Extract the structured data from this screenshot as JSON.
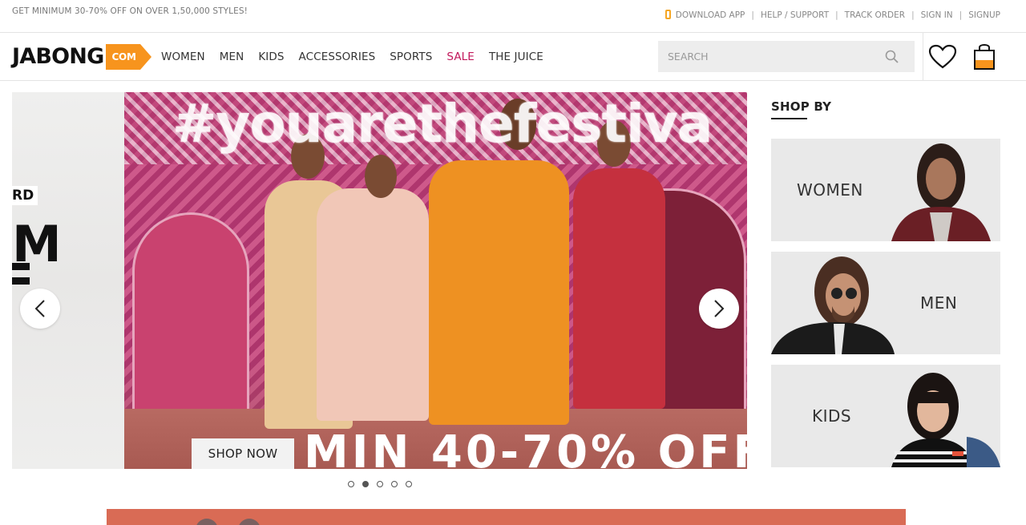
{
  "topbar": {
    "promo": "GET MINIMUM 30-70% OFF ON OVER 1,50,000 STYLES!",
    "links": [
      "DOWNLOAD APP",
      "HELP / SUPPORT",
      "TRACK ORDER",
      "SIGN IN",
      "SIGNUP"
    ]
  },
  "header": {
    "logo_text": "JABONG",
    "logo_tag": "COM",
    "nav": [
      "WOMEN",
      "MEN",
      "KIDS",
      "ACCESSORIES",
      "SPORTS",
      "SALE",
      "THE JUICE"
    ],
    "search_placeholder": "SEARCH",
    "accent": "#f7941d",
    "sale_color": "#c2185b"
  },
  "banner": {
    "hashtag": "#youarethefestiva",
    "left_fragment": "RD",
    "left_big": "M",
    "shop_now": "SHOP NOW",
    "offer": "MIN 40-70% OFF",
    "slide_count": 5,
    "active_slide": 2
  },
  "shop_by": {
    "title": "SHOP BY",
    "tiles": [
      "WOMEN",
      "MEN",
      "KIDS"
    ]
  }
}
